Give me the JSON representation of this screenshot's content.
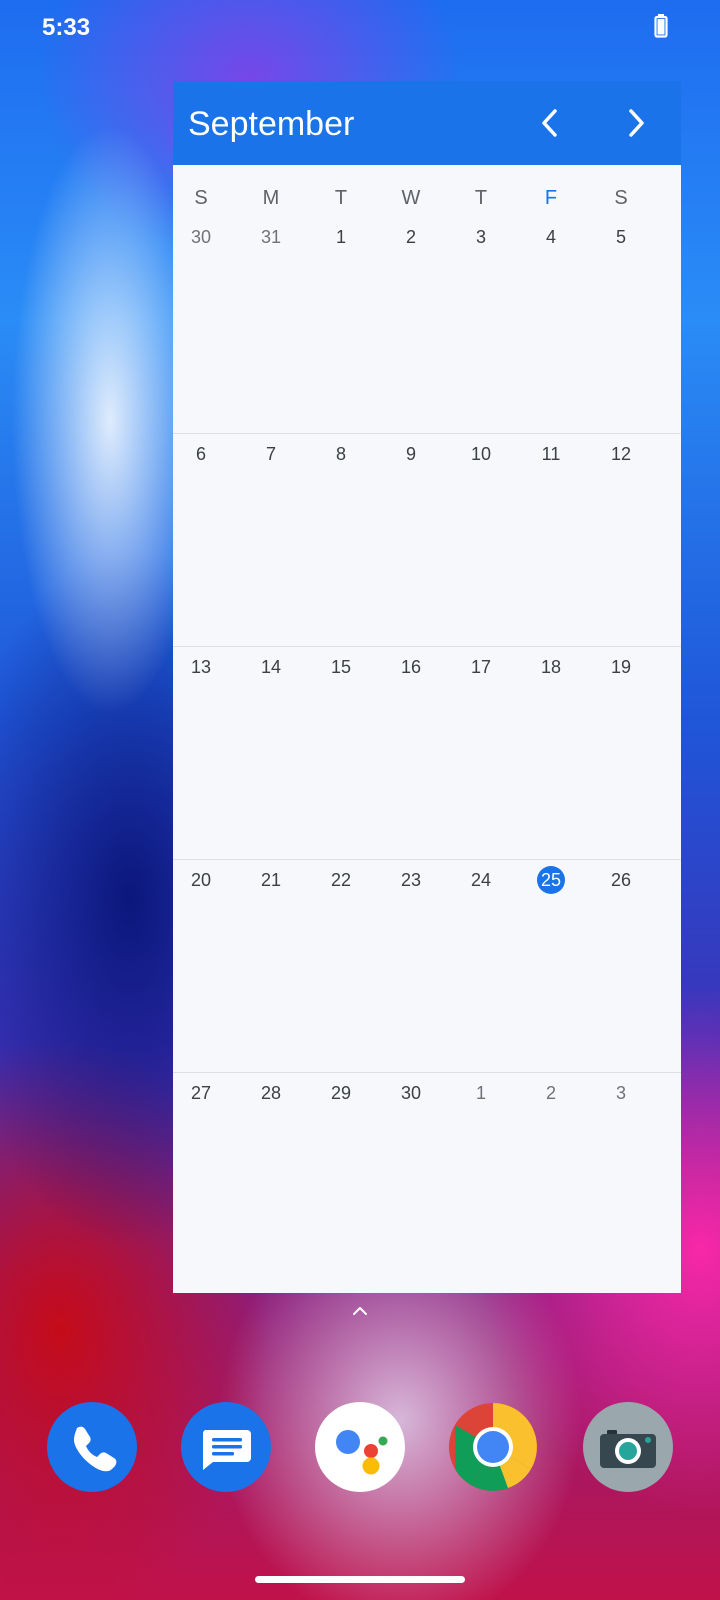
{
  "status_bar": {
    "time": "5:33",
    "battery_icon": "battery-icon"
  },
  "calendar_widget": {
    "month": "September",
    "prev_icon": "chevron-left-icon",
    "next_icon": "chevron-right-icon",
    "weekdays": [
      "S",
      "M",
      "T",
      "W",
      "T",
      "F",
      "S"
    ],
    "weeks": [
      [
        "30",
        "31",
        "1",
        "2",
        "3",
        "4",
        "5"
      ],
      [
        "6",
        "7",
        "8",
        "9",
        "10",
        "11",
        "12"
      ],
      [
        "13",
        "14",
        "15",
        "16",
        "17",
        "18",
        "19"
      ],
      [
        "20",
        "21",
        "22",
        "23",
        "24",
        "25",
        "26"
      ],
      [
        "27",
        "28",
        "29",
        "30",
        "1",
        "2",
        "3"
      ]
    ],
    "today": "25"
  },
  "dock": {
    "apps": [
      {
        "name": "Phone",
        "icon": "phone-icon"
      },
      {
        "name": "Messages",
        "icon": "messages-icon"
      },
      {
        "name": "Assistant",
        "icon": "assistant-icon"
      },
      {
        "name": "Chrome",
        "icon": "chrome-icon"
      },
      {
        "name": "Camera",
        "icon": "camera-icon"
      }
    ]
  },
  "colors": {
    "accent": "#1a73e8",
    "widget_bg": "#f6f8fb"
  }
}
